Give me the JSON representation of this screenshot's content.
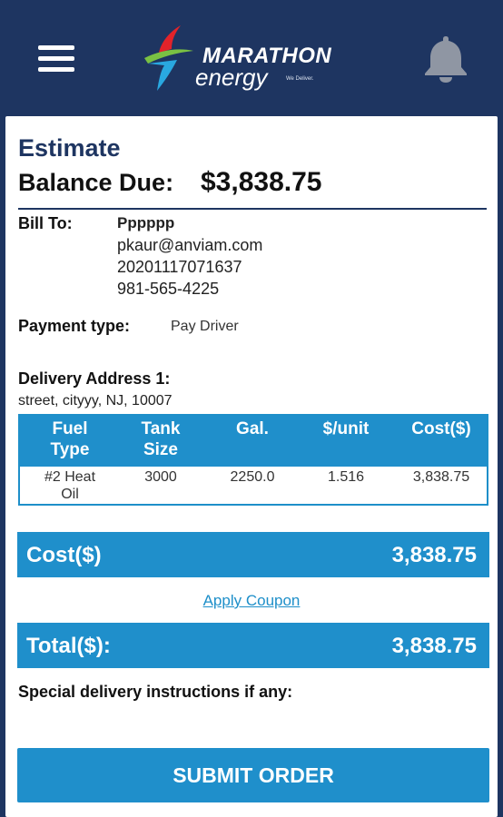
{
  "header": {
    "brand_name": "MARATHON",
    "brand_sub": "energy",
    "brand_tagline": "We Deliver."
  },
  "estimate": {
    "title": "Estimate",
    "balance_label": "Balance Due:",
    "balance_value": "$3,838.75"
  },
  "bill_to": {
    "label": "Bill To:",
    "name": "Pppppp",
    "email": "pkaur@anviam.com",
    "account": "20201117071637",
    "phone": "981-565-4225"
  },
  "payment": {
    "label": "Payment type:",
    "value": "Pay Driver"
  },
  "delivery": {
    "label": "Delivery Address 1:",
    "address": "street, cityyy, NJ, 10007"
  },
  "table": {
    "headers": [
      {
        "line1": "Fuel",
        "line2": "Type"
      },
      {
        "line1": "Tank",
        "line2": "Size"
      },
      {
        "line1": "Gal.",
        "line2": ""
      },
      {
        "line1": "$/unit",
        "line2": ""
      },
      {
        "line1": "Cost($)",
        "line2": ""
      }
    ],
    "row": {
      "fuel_type_line1": "#2 Heat",
      "fuel_type_line2": "Oil",
      "tank_size": "3000",
      "gallons": "2250.0",
      "unit_price": "1.516",
      "cost": "3,838.75"
    }
  },
  "cost_bar": {
    "label": "Cost($)",
    "value": "3,838.75"
  },
  "coupon_link": "Apply Coupon",
  "total_bar": {
    "label": "Total($):",
    "value": "3,838.75"
  },
  "special_label": "Special delivery instructions if any:",
  "submit_label": "SUBMIT ORDER",
  "colors": {
    "header_bg": "#1e3561",
    "accent": "#1f8fcb",
    "bell_icon": "#8f96a3"
  }
}
